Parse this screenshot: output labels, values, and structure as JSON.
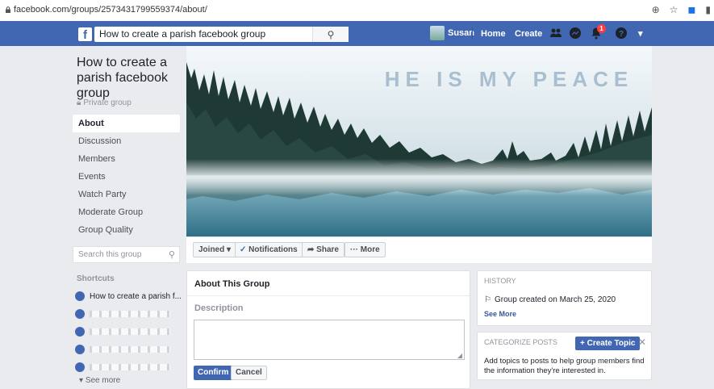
{
  "browser": {
    "url": "facebook.com/groups/2573431799559374/about/"
  },
  "topbar": {
    "logo": "f",
    "search_value": "How to create a parish facebook group",
    "user_name": "Susan",
    "home_label": "Home",
    "create_label": "Create",
    "notification_count": "1"
  },
  "group": {
    "title": "How to create a parish facebook group",
    "privacy": "Private group",
    "cover_text": "HE IS MY PEACE"
  },
  "menu": {
    "items": [
      {
        "label": "About"
      },
      {
        "label": "Discussion"
      },
      {
        "label": "Members"
      },
      {
        "label": "Events"
      },
      {
        "label": "Watch Party"
      },
      {
        "label": "Moderate Group"
      },
      {
        "label": "Group Quality"
      }
    ]
  },
  "group_search": {
    "placeholder": "Search this group"
  },
  "shortcuts": {
    "header": "Shortcuts",
    "items": [
      {
        "label": "How to create a parish f..."
      }
    ],
    "see_more": "See more"
  },
  "actions": {
    "joined": "Joined ▾",
    "notifications": "Notifications",
    "share": "Share",
    "more": "More"
  },
  "about_card": {
    "title": "About This Group",
    "description_label": "Description",
    "confirm_label": "Confirm",
    "cancel_label": "Cancel"
  },
  "history_card": {
    "header": "HISTORY",
    "text": "Group created on March 25, 2020",
    "see_more": "See More"
  },
  "categorize_card": {
    "header": "CATEGORIZE POSTS",
    "button_label": "+ Create Topic",
    "text": "Add topics to posts to help group members find the information they're interested in."
  },
  "colors": {
    "facebook_blue": "#4267b2",
    "page_bg": "#e9ebee",
    "notification_red": "#fa3e3e"
  }
}
